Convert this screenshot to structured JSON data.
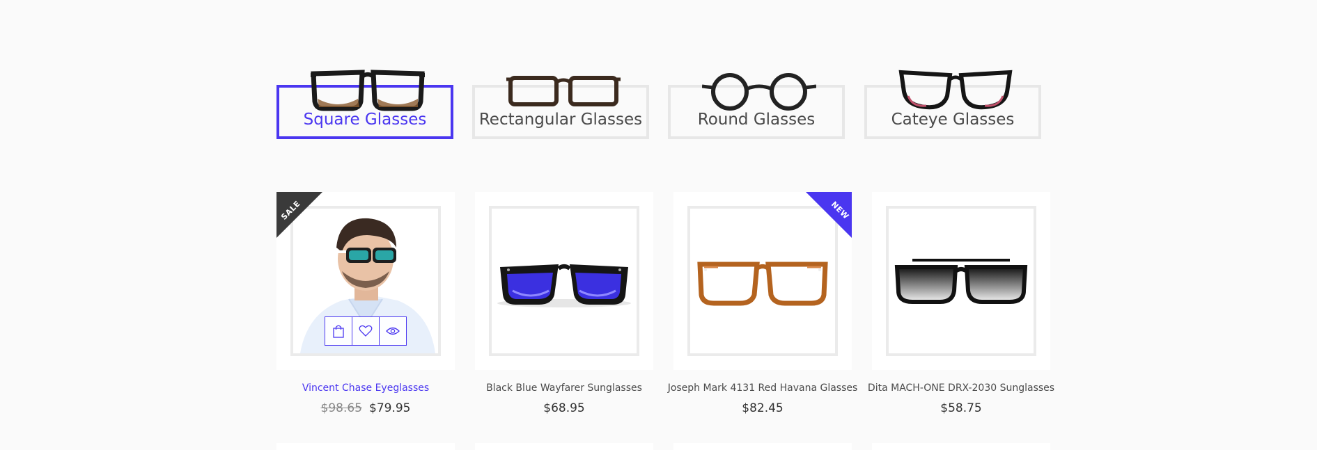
{
  "categories": {
    "items": [
      {
        "label": "Square Glasses",
        "active": true
      },
      {
        "label": "Rectangular Glasses",
        "active": false
      },
      {
        "label": "Round Glasses",
        "active": false
      },
      {
        "label": "Cateye Glasses",
        "active": false
      }
    ]
  },
  "products": [
    {
      "title": "Vincent Chase Eyeglasses",
      "old_price": "$98.65",
      "price": "$79.95",
      "badge": "SALE",
      "icon": "model-with-sunglasses-image",
      "hovered": true
    },
    {
      "title": "Black Blue Wayfarer Sunglasses",
      "old_price": "",
      "price": "$68.95",
      "badge": "",
      "icon": "wayfarer-sunglasses-image"
    },
    {
      "title": "Joseph Mark 4131 Red Havana Glasses",
      "old_price": "",
      "price": "$82.45",
      "badge": "NEW",
      "icon": "havana-glasses-image"
    },
    {
      "title": "Dita MACH-ONE DRX-2030 Sunglasses",
      "old_price": "",
      "price": "$58.75",
      "badge": "",
      "icon": "aviator-sunglasses-image"
    }
  ],
  "product_actions": {
    "icons": [
      "shopping-bag-icon",
      "heart-icon",
      "eye-icon"
    ]
  },
  "colors": {
    "accent": "#4a36f0",
    "sale_badge": "#3a3a3a",
    "new_badge": "#4a36f0",
    "border": "#e7e7e7"
  }
}
